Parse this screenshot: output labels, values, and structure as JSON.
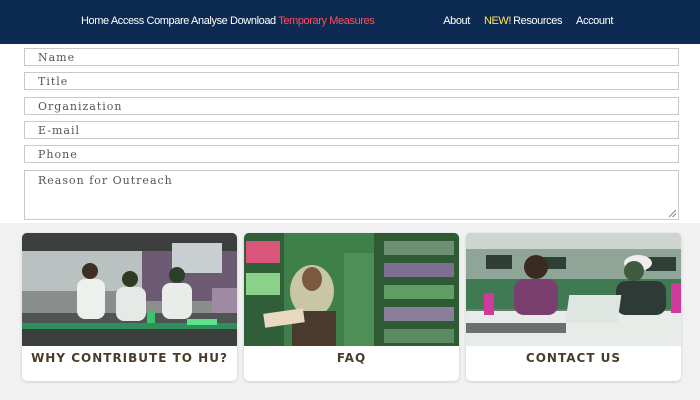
{
  "nav": {
    "left_items": [
      "Home",
      "Access",
      "Compare",
      "Analyse",
      "Download"
    ],
    "highlight_item": "Temporary Measures",
    "about": "About",
    "new_badge": "NEW!",
    "resources": "Resources",
    "account": "Account"
  },
  "form": {
    "name_placeholder": "Name",
    "title_placeholder": "Title",
    "organization_placeholder": "Organization",
    "email_placeholder": "E-mail",
    "phone_placeholder": "Phone",
    "reason_placeholder": "Reason for Outreach"
  },
  "cards": [
    {
      "label": "WHY CONTRIBUTE TO HU?"
    },
    {
      "label": "FAQ"
    },
    {
      "label": "CONTACT US"
    }
  ],
  "colors": {
    "header_bg": "#0d2b52",
    "highlight": "#ff4d5a",
    "new_badge": "#ffe35a",
    "card_label": "#4a3b2a"
  }
}
